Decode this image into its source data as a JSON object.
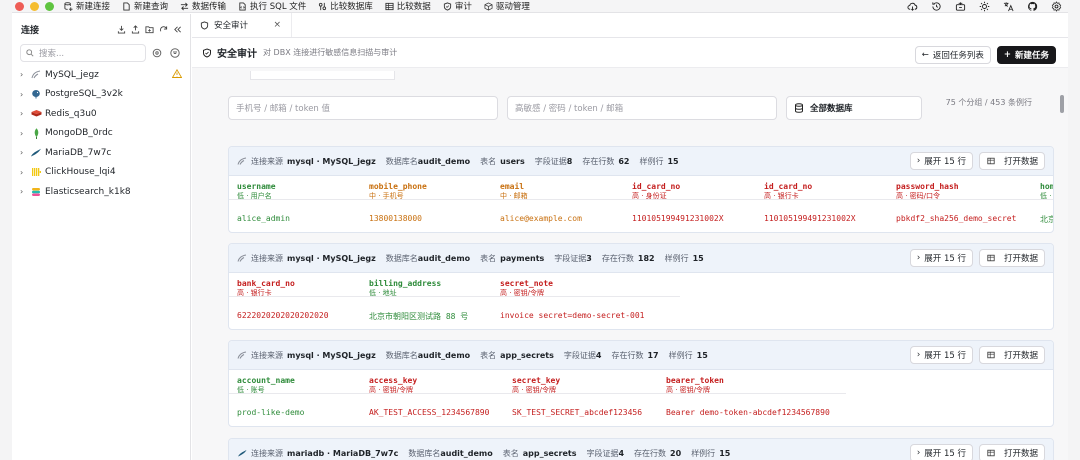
{
  "window": {
    "traffic_lights": [
      "#ee5d56",
      "#f5bd2f",
      "#5fc440"
    ]
  },
  "toolbar": {
    "items": [
      {
        "label": "新建连接",
        "icon": "db-plus-icon"
      },
      {
        "label": "新建查询",
        "icon": "file-icon"
      },
      {
        "label": "数据传输",
        "icon": "transfer-icon"
      },
      {
        "label": "执行 SQL 文件",
        "icon": "file-code-icon"
      },
      {
        "label": "比较数据库",
        "icon": "compare-db-icon"
      },
      {
        "label": "比较数据",
        "icon": "table-icon"
      },
      {
        "label": "审计",
        "icon": "shield-icon"
      },
      {
        "label": "驱动管理",
        "icon": "package-icon"
      }
    ],
    "right_icons": [
      "cloud-sync-icon",
      "history-icon",
      "layout-icon",
      "sun-icon",
      "translate-icon",
      "github-icon",
      "settings-icon"
    ]
  },
  "sidebar": {
    "title": "连接",
    "search_placeholder": "搜索...",
    "connections": [
      {
        "name": "MySQL_jegz",
        "icon": "mysql-icon",
        "color": "#8a8f99",
        "warning": true
      },
      {
        "name": "PostgreSQL_3v2k",
        "icon": "postgresql-icon",
        "color": "#336791",
        "warning": false
      },
      {
        "name": "Redis_q3u0",
        "icon": "redis-icon",
        "color": "#c8321e",
        "warning": false
      },
      {
        "name": "MongoDB_0rdc",
        "icon": "mongodb-icon",
        "color": "#4aa746",
        "warning": false
      },
      {
        "name": "MariaDB_7w7c",
        "icon": "mariadb-icon",
        "color": "#1f5a7a",
        "warning": false
      },
      {
        "name": "ClickHouse_lqi4",
        "icon": "clickhouse-icon",
        "color": "#f2c812",
        "warning": false
      },
      {
        "name": "Elasticsearch_k1k8",
        "icon": "elasticsearch-icon",
        "color": "#f0b41b",
        "warning": false
      }
    ]
  },
  "tab": {
    "label": "安全审计",
    "close": "×"
  },
  "header": {
    "title": "安全审计",
    "subtitle": "对 DBX 连接进行敏感信息扫描与审计",
    "back_label": "返回任务列表",
    "new_label": "新建任务"
  },
  "filters": {
    "value_placeholder": "手机号 / 邮箱 / token 值",
    "field_placeholder": "高敏感 / 密码 / token / 邮箱",
    "db_select": "全部数据库",
    "stats": "75 个分组 / 453 条例行"
  },
  "labels": {
    "source": "连接来源",
    "dbname": "数据库名",
    "table": "表名",
    "evidence": "字段证据",
    "rows": "存在行数",
    "sample": "样例行",
    "open": "打开数据"
  },
  "results": [
    {
      "engine": "mysql",
      "conn": "MySQL_jegz",
      "db": "audit_demo",
      "table": "users",
      "evidence": "8",
      "rows": "62",
      "sample": "15",
      "expand": "展开 15 行",
      "columns": [
        {
          "name": "username",
          "tag": "低 · 用户名",
          "level": "low",
          "value": "alice_admin"
        },
        {
          "name": "mobile_phone",
          "tag": "中 · 手机号",
          "level": "mid",
          "value": "13800138000"
        },
        {
          "name": "email",
          "tag": "中 · 邮箱",
          "level": "mid",
          "value": "alice@example.com"
        },
        {
          "name": "id_card_no",
          "tag": "高 · 身份证",
          "level": "high",
          "value": "110105199491231002X"
        },
        {
          "name": "id_card_no",
          "tag": "高 · 银行卡",
          "level": "high",
          "value": "110105199491231002X"
        },
        {
          "name": "password_hash",
          "tag": "高 · 密码/口令",
          "level": "high",
          "value": "pbkdf2_sha256_demo_secret"
        },
        {
          "name": "home",
          "tag": "低 · 地",
          "level": "low",
          "value": "北京"
        }
      ]
    },
    {
      "engine": "mysql",
      "conn": "MySQL_jegz",
      "db": "audit_demo",
      "table": "payments",
      "evidence": "3",
      "rows": "182",
      "sample": "15",
      "expand": "展开 15 行",
      "columns": [
        {
          "name": "bank_card_no",
          "tag": "高 · 银行卡",
          "level": "high",
          "value": "6222020202020202020"
        },
        {
          "name": "billing_address",
          "tag": "低 · 地址",
          "level": "low",
          "value": "北京市朝阳区测试路 88 号"
        },
        {
          "name": "secret_note",
          "tag": "高 · 密钥/令牌",
          "level": "high",
          "value": "invoice secret=demo-secret-001"
        }
      ]
    },
    {
      "engine": "mysql",
      "conn": "MySQL_jegz",
      "db": "audit_demo",
      "table": "app_secrets",
      "evidence": "4",
      "rows": "17",
      "sample": "15",
      "expand": "展开 15 行",
      "columns": [
        {
          "name": "account_name",
          "tag": "低 · 账号",
          "level": "low",
          "value": "prod-like-demo"
        },
        {
          "name": "access_key",
          "tag": "高 · 密钥/令牌",
          "level": "high",
          "value": "AK_TEST_ACCESS_1234567890"
        },
        {
          "name": "secret_key",
          "tag": "高 · 密钥/令牌",
          "level": "high",
          "value": "SK_TEST_SECRET_abcdef123456"
        },
        {
          "name": "bearer_token",
          "tag": "高 · 密钥/令牌",
          "level": "high",
          "value": "Bearer demo-token-abcdef1234567890"
        }
      ]
    },
    {
      "engine": "mariadb",
      "conn": "MariaDB_7w7c",
      "db": "audit_demo",
      "table": "app_secrets",
      "evidence": "4",
      "rows": "20",
      "sample": "15",
      "expand": "展开 15 行",
      "columns": []
    }
  ]
}
